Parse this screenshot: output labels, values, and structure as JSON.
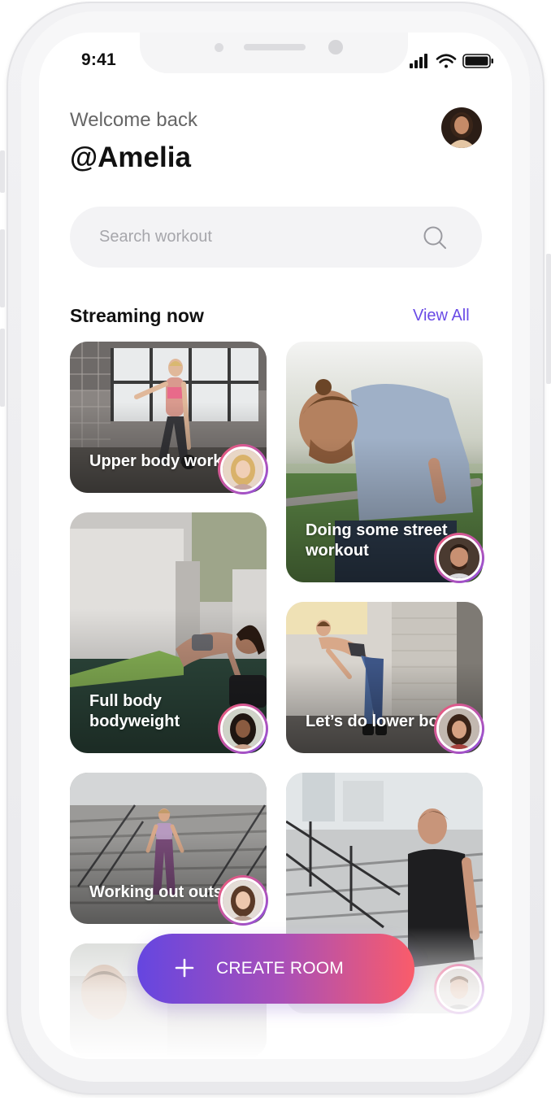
{
  "status_bar": {
    "time": "9:41",
    "icons": [
      "signal-icon",
      "wifi-icon",
      "battery-icon"
    ]
  },
  "header": {
    "welcome": "Welcome back",
    "username": "@Amelia",
    "avatar_icon": "user-avatar-icon"
  },
  "search": {
    "placeholder": "Search workout",
    "value": "",
    "icon": "search-icon"
  },
  "section": {
    "title": "Streaming now",
    "view_all": "View All"
  },
  "cards": [
    {
      "title": "Upper body workout"
    },
    {
      "title": "Doing some street workout"
    },
    {
      "title": "Full body bodyweight"
    },
    {
      "title": "Let’s do lower body!"
    },
    {
      "title": "Working out outside"
    },
    {
      "title": ""
    },
    {
      "title": ""
    }
  ],
  "create_button": {
    "label": "CREATE ROOM",
    "icon": "plus-icon"
  },
  "colors": {
    "accent": "#6a4be6",
    "gradient_start": "#6546e0",
    "gradient_end": "#fa5c6a",
    "ring_start": "#f25c74",
    "ring_end": "#8b4fe0"
  }
}
